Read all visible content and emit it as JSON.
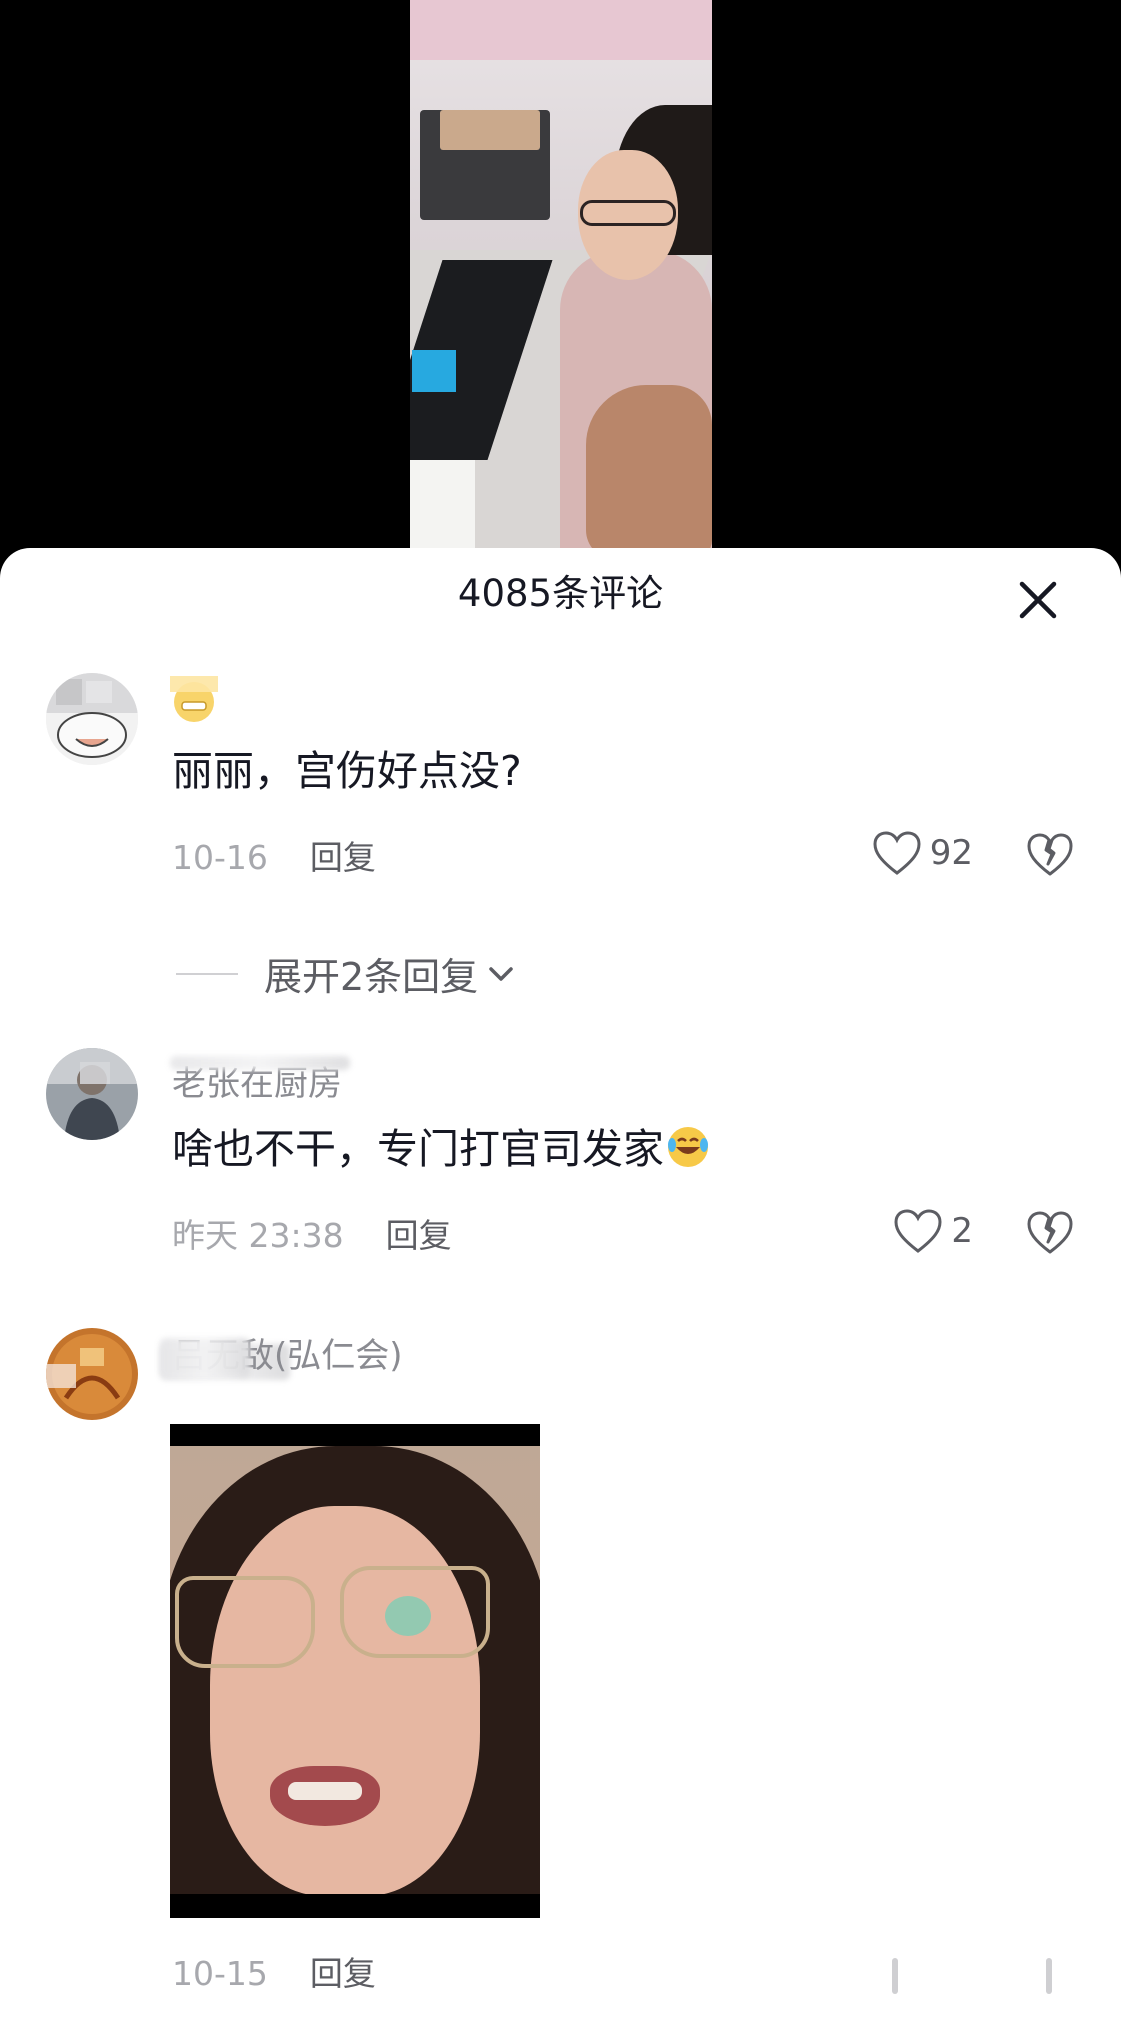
{
  "sheet": {
    "title": "4085条评论"
  },
  "comments": [
    {
      "username": "",
      "content": "丽丽，宫伤好点没?",
      "time": "10-16",
      "reply_label": "回复",
      "likes": "92",
      "expand_label": "展开2条回复"
    },
    {
      "username": "老张在厨房",
      "content": "啥也不干，专门打官司发家",
      "time": "昨天 23:38",
      "reply_label": "回复",
      "likes": "2"
    },
    {
      "username": "吕无敌(弘仁会)",
      "time": "10-15",
      "reply_label": "回复"
    }
  ],
  "icons": {
    "close": "close-icon",
    "like": "heart-icon",
    "dislike": "broken-heart-icon",
    "expand": "chevron-down-icon",
    "emoji_grin": "grinning-emoji-icon",
    "emoji_laugh": "laughing-tears-emoji-icon"
  },
  "colors": {
    "primary_text": "#161823",
    "secondary_text": "#8a8b91",
    "meta_text": "#a7a8ad"
  }
}
